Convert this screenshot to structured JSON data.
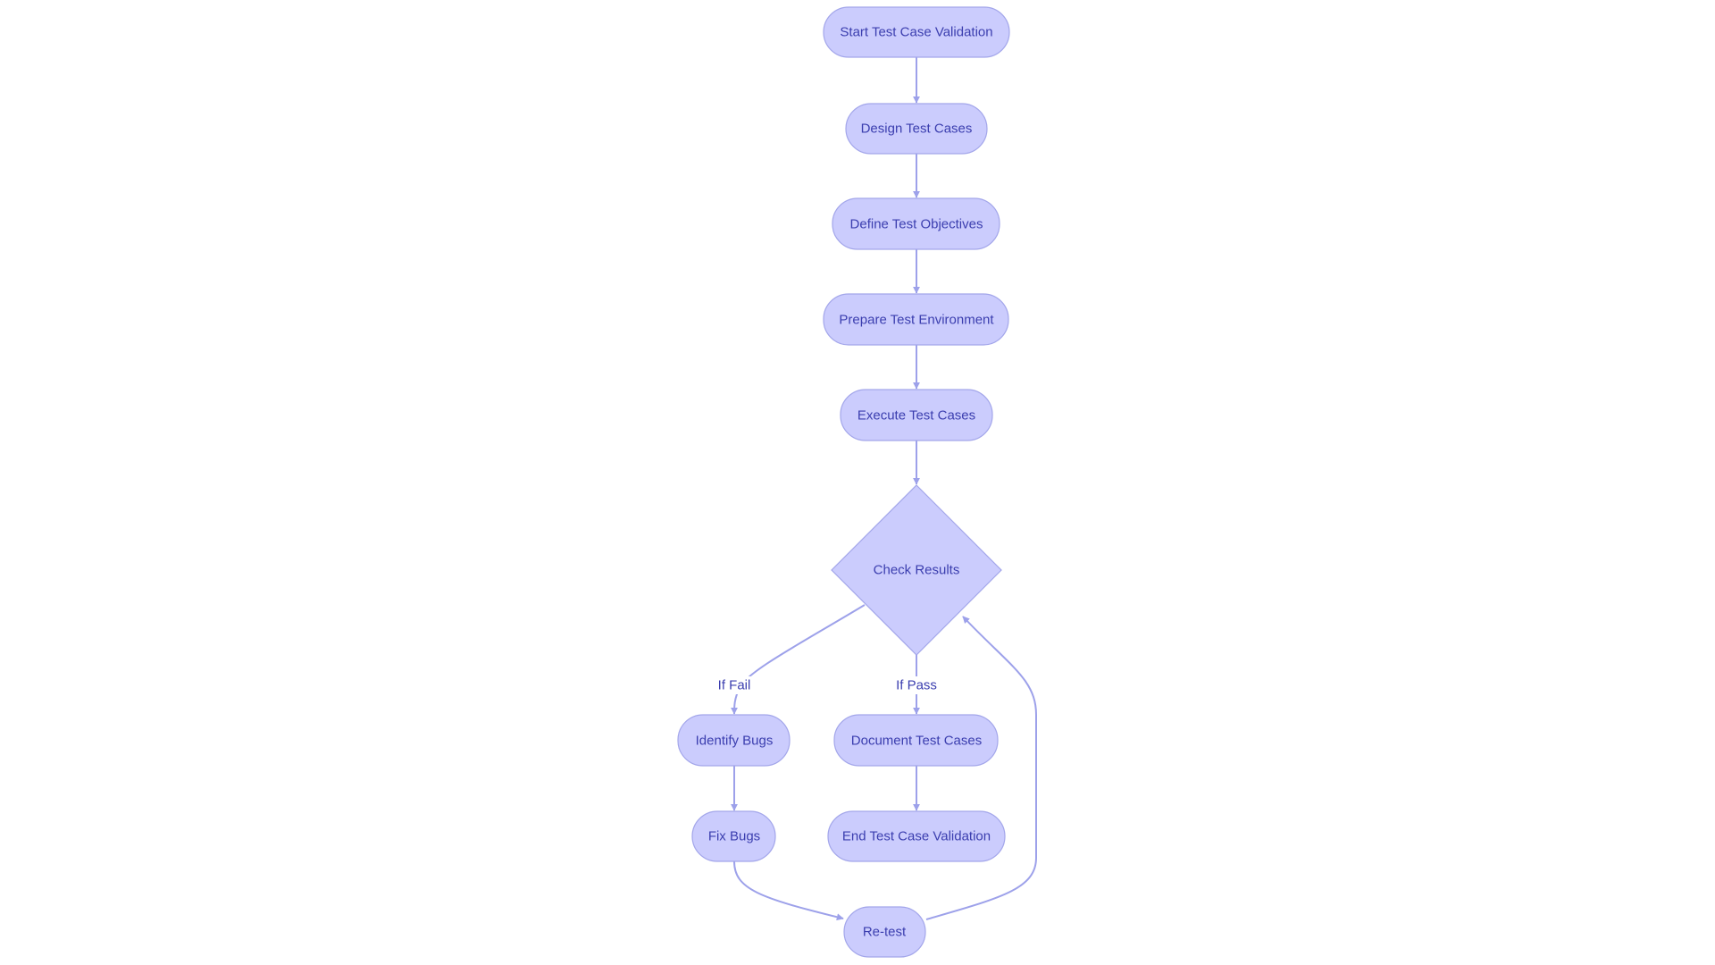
{
  "diagram": {
    "type": "flowchart",
    "direction": "top-down",
    "colors": {
      "node_fill": "#cbccfd",
      "node_stroke": "#a3a6ea",
      "edge": "#9da1ea",
      "text": "#3b3eaf"
    },
    "nodes": [
      {
        "id": "start",
        "label": "Start Test Case Validation",
        "shape": "stadium"
      },
      {
        "id": "design",
        "label": "Design Test Cases",
        "shape": "stadium"
      },
      {
        "id": "define",
        "label": "Define Test Objectives",
        "shape": "stadium"
      },
      {
        "id": "prepare",
        "label": "Prepare Test Environment",
        "shape": "stadium"
      },
      {
        "id": "execute",
        "label": "Execute Test Cases",
        "shape": "stadium"
      },
      {
        "id": "check",
        "label": "Check Results",
        "shape": "diamond"
      },
      {
        "id": "identify",
        "label": "Identify Bugs",
        "shape": "stadium"
      },
      {
        "id": "document",
        "label": "Document Test Cases",
        "shape": "stadium"
      },
      {
        "id": "fix",
        "label": "Fix Bugs",
        "shape": "stadium"
      },
      {
        "id": "end",
        "label": "End Test Case Validation",
        "shape": "stadium"
      },
      {
        "id": "retest",
        "label": "Re-test",
        "shape": "stadium"
      }
    ],
    "edges": [
      {
        "from": "start",
        "to": "design",
        "label": ""
      },
      {
        "from": "design",
        "to": "define",
        "label": ""
      },
      {
        "from": "define",
        "to": "prepare",
        "label": ""
      },
      {
        "from": "prepare",
        "to": "execute",
        "label": ""
      },
      {
        "from": "execute",
        "to": "check",
        "label": ""
      },
      {
        "from": "check",
        "to": "identify",
        "label": "If Fail"
      },
      {
        "from": "check",
        "to": "document",
        "label": "If Pass"
      },
      {
        "from": "identify",
        "to": "fix",
        "label": ""
      },
      {
        "from": "document",
        "to": "end",
        "label": ""
      },
      {
        "from": "fix",
        "to": "retest",
        "label": ""
      },
      {
        "from": "retest",
        "to": "check",
        "label": ""
      }
    ]
  }
}
